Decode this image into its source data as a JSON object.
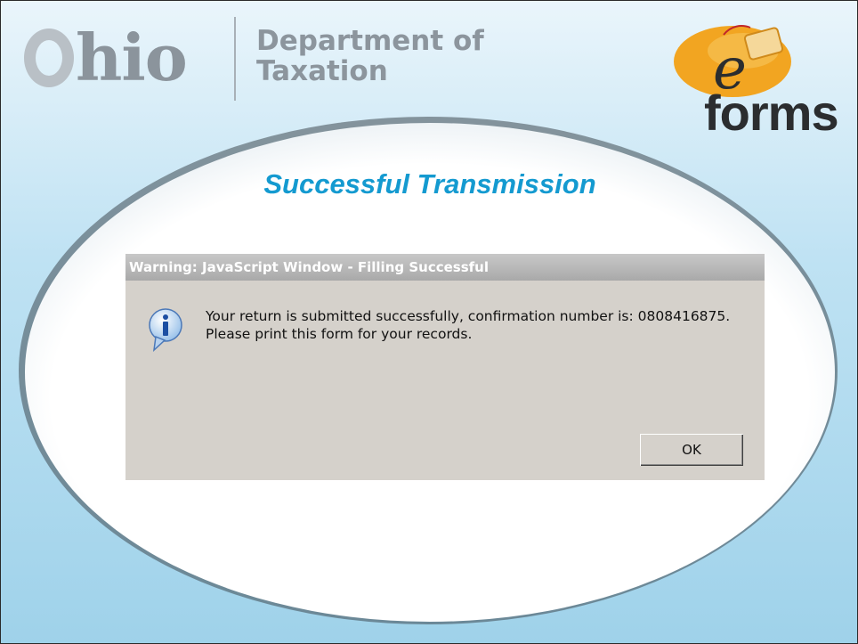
{
  "header": {
    "ohio_logo_text": "Ohio",
    "department_line1": "Department of",
    "department_line2": "Taxation",
    "eforms_letter": "e",
    "eforms_word": "forms"
  },
  "banner": {
    "title": "Successful Transmission"
  },
  "dialog": {
    "title": "Warning: JavaScript Window - Filling Successful",
    "message_line1": "Your return is submitted successfully, confirmation number is: 0808416875.",
    "message_line2": "Please print this form for your records.",
    "ok_label": "OK",
    "icon": "info-icon"
  },
  "colors": {
    "background_blue": "#a8d6ec",
    "title_blue": "#149ad0",
    "dialog_gray": "#d5d1cb",
    "eforms_orange": "#f2a521"
  }
}
